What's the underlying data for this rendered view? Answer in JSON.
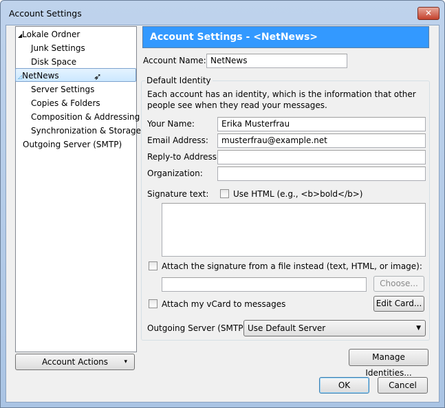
{
  "window": {
    "title": "Account Settings",
    "close": "✕"
  },
  "tree": {
    "items": [
      {
        "label": "Lokale Ordner",
        "expander": "◢",
        "level": 0
      },
      {
        "label": "Junk Settings",
        "level": 1
      },
      {
        "label": "Disk Space",
        "level": 1
      },
      {
        "label": "NetNews",
        "expander": "◿",
        "level": 0,
        "selected": true
      },
      {
        "label": "Server Settings",
        "level": 1
      },
      {
        "label": "Copies & Folders",
        "level": 1
      },
      {
        "label": "Composition & Addressing",
        "level": 1
      },
      {
        "label": "Synchronization & Storage",
        "level": 1
      },
      {
        "label": "Outgoing Server (SMTP)",
        "level": 0
      }
    ]
  },
  "account_actions": {
    "label": "Account Actions",
    "arrow": "▾"
  },
  "header": {
    "title": "Account Settings - <NetNews>"
  },
  "account_name": {
    "label": "Account Name:",
    "value": "NetNews"
  },
  "identity": {
    "legend": "Default Identity",
    "description": "Each account has an identity, which is the information that other people see when they read your messages.",
    "your_name": {
      "label": "Your Name:",
      "value": "Erika Musterfrau"
    },
    "email": {
      "label": "Email Address:",
      "value": "musterfrau@example.net"
    },
    "reply_to": {
      "label": "Reply-to Address:",
      "value": ""
    },
    "organization": {
      "label": "Organization:",
      "value": ""
    },
    "signature_label": "Signature text:",
    "use_html": {
      "label": "Use HTML (e.g., <b>bold</b>)",
      "checked": false
    },
    "signature_text": "",
    "attach_file": {
      "label": "Attach the signature from a file instead (text, HTML, or image):",
      "checked": false
    },
    "file_path": "",
    "choose": "Choose...",
    "vcard": {
      "label": "Attach my vCard to messages",
      "checked": false
    },
    "edit_card": "Edit Card...",
    "outgoing": {
      "label": "Outgoing Server (SMTP):",
      "value": "Use Default Server"
    }
  },
  "manage_identities": "Manage Identities...",
  "ok": "OK",
  "cancel": "Cancel"
}
